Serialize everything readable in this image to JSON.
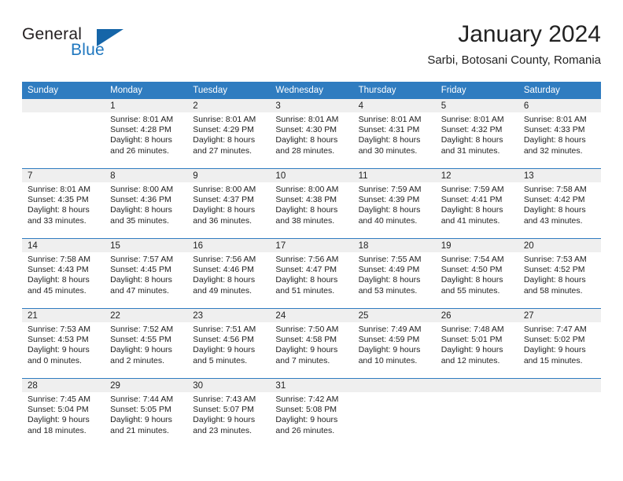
{
  "brand": {
    "line1": "General",
    "line2": "Blue",
    "triangle_color": "#1565a8",
    "blue_text_color": "#1f77bf"
  },
  "header": {
    "month_title": "January 2024",
    "location": "Sarbi, Botosani County, Romania"
  },
  "theme": {
    "header_blue": "#2f7cc0",
    "band_gray": "#efefef",
    "text": "#222222"
  },
  "calendar": {
    "weekday_headers": [
      "Sunday",
      "Monday",
      "Tuesday",
      "Wednesday",
      "Thursday",
      "Friday",
      "Saturday"
    ],
    "weeks": [
      [
        {
          "day": "",
          "sunrise": "",
          "sunset": "",
          "daylight_line1": "",
          "daylight_line2": "",
          "empty": true
        },
        {
          "day": "1",
          "sunrise": "Sunrise: 8:01 AM",
          "sunset": "Sunset: 4:28 PM",
          "daylight_line1": "Daylight: 8 hours",
          "daylight_line2": "and 26 minutes."
        },
        {
          "day": "2",
          "sunrise": "Sunrise: 8:01 AM",
          "sunset": "Sunset: 4:29 PM",
          "daylight_line1": "Daylight: 8 hours",
          "daylight_line2": "and 27 minutes."
        },
        {
          "day": "3",
          "sunrise": "Sunrise: 8:01 AM",
          "sunset": "Sunset: 4:30 PM",
          "daylight_line1": "Daylight: 8 hours",
          "daylight_line2": "and 28 minutes."
        },
        {
          "day": "4",
          "sunrise": "Sunrise: 8:01 AM",
          "sunset": "Sunset: 4:31 PM",
          "daylight_line1": "Daylight: 8 hours",
          "daylight_line2": "and 30 minutes."
        },
        {
          "day": "5",
          "sunrise": "Sunrise: 8:01 AM",
          "sunset": "Sunset: 4:32 PM",
          "daylight_line1": "Daylight: 8 hours",
          "daylight_line2": "and 31 minutes."
        },
        {
          "day": "6",
          "sunrise": "Sunrise: 8:01 AM",
          "sunset": "Sunset: 4:33 PM",
          "daylight_line1": "Daylight: 8 hours",
          "daylight_line2": "and 32 minutes."
        }
      ],
      [
        {
          "day": "7",
          "sunrise": "Sunrise: 8:01 AM",
          "sunset": "Sunset: 4:35 PM",
          "daylight_line1": "Daylight: 8 hours",
          "daylight_line2": "and 33 minutes."
        },
        {
          "day": "8",
          "sunrise": "Sunrise: 8:00 AM",
          "sunset": "Sunset: 4:36 PM",
          "daylight_line1": "Daylight: 8 hours",
          "daylight_line2": "and 35 minutes."
        },
        {
          "day": "9",
          "sunrise": "Sunrise: 8:00 AM",
          "sunset": "Sunset: 4:37 PM",
          "daylight_line1": "Daylight: 8 hours",
          "daylight_line2": "and 36 minutes."
        },
        {
          "day": "10",
          "sunrise": "Sunrise: 8:00 AM",
          "sunset": "Sunset: 4:38 PM",
          "daylight_line1": "Daylight: 8 hours",
          "daylight_line2": "and 38 minutes."
        },
        {
          "day": "11",
          "sunrise": "Sunrise: 7:59 AM",
          "sunset": "Sunset: 4:39 PM",
          "daylight_line1": "Daylight: 8 hours",
          "daylight_line2": "and 40 minutes."
        },
        {
          "day": "12",
          "sunrise": "Sunrise: 7:59 AM",
          "sunset": "Sunset: 4:41 PM",
          "daylight_line1": "Daylight: 8 hours",
          "daylight_line2": "and 41 minutes."
        },
        {
          "day": "13",
          "sunrise": "Sunrise: 7:58 AM",
          "sunset": "Sunset: 4:42 PM",
          "daylight_line1": "Daylight: 8 hours",
          "daylight_line2": "and 43 minutes."
        }
      ],
      [
        {
          "day": "14",
          "sunrise": "Sunrise: 7:58 AM",
          "sunset": "Sunset: 4:43 PM",
          "daylight_line1": "Daylight: 8 hours",
          "daylight_line2": "and 45 minutes."
        },
        {
          "day": "15",
          "sunrise": "Sunrise: 7:57 AM",
          "sunset": "Sunset: 4:45 PM",
          "daylight_line1": "Daylight: 8 hours",
          "daylight_line2": "and 47 minutes."
        },
        {
          "day": "16",
          "sunrise": "Sunrise: 7:56 AM",
          "sunset": "Sunset: 4:46 PM",
          "daylight_line1": "Daylight: 8 hours",
          "daylight_line2": "and 49 minutes."
        },
        {
          "day": "17",
          "sunrise": "Sunrise: 7:56 AM",
          "sunset": "Sunset: 4:47 PM",
          "daylight_line1": "Daylight: 8 hours",
          "daylight_line2": "and 51 minutes."
        },
        {
          "day": "18",
          "sunrise": "Sunrise: 7:55 AM",
          "sunset": "Sunset: 4:49 PM",
          "daylight_line1": "Daylight: 8 hours",
          "daylight_line2": "and 53 minutes."
        },
        {
          "day": "19",
          "sunrise": "Sunrise: 7:54 AM",
          "sunset": "Sunset: 4:50 PM",
          "daylight_line1": "Daylight: 8 hours",
          "daylight_line2": "and 55 minutes."
        },
        {
          "day": "20",
          "sunrise": "Sunrise: 7:53 AM",
          "sunset": "Sunset: 4:52 PM",
          "daylight_line1": "Daylight: 8 hours",
          "daylight_line2": "and 58 minutes."
        }
      ],
      [
        {
          "day": "21",
          "sunrise": "Sunrise: 7:53 AM",
          "sunset": "Sunset: 4:53 PM",
          "daylight_line1": "Daylight: 9 hours",
          "daylight_line2": "and 0 minutes."
        },
        {
          "day": "22",
          "sunrise": "Sunrise: 7:52 AM",
          "sunset": "Sunset: 4:55 PM",
          "daylight_line1": "Daylight: 9 hours",
          "daylight_line2": "and 2 minutes."
        },
        {
          "day": "23",
          "sunrise": "Sunrise: 7:51 AM",
          "sunset": "Sunset: 4:56 PM",
          "daylight_line1": "Daylight: 9 hours",
          "daylight_line2": "and 5 minutes."
        },
        {
          "day": "24",
          "sunrise": "Sunrise: 7:50 AM",
          "sunset": "Sunset: 4:58 PM",
          "daylight_line1": "Daylight: 9 hours",
          "daylight_line2": "and 7 minutes."
        },
        {
          "day": "25",
          "sunrise": "Sunrise: 7:49 AM",
          "sunset": "Sunset: 4:59 PM",
          "daylight_line1": "Daylight: 9 hours",
          "daylight_line2": "and 10 minutes."
        },
        {
          "day": "26",
          "sunrise": "Sunrise: 7:48 AM",
          "sunset": "Sunset: 5:01 PM",
          "daylight_line1": "Daylight: 9 hours",
          "daylight_line2": "and 12 minutes."
        },
        {
          "day": "27",
          "sunrise": "Sunrise: 7:47 AM",
          "sunset": "Sunset: 5:02 PM",
          "daylight_line1": "Daylight: 9 hours",
          "daylight_line2": "and 15 minutes."
        }
      ],
      [
        {
          "day": "28",
          "sunrise": "Sunrise: 7:45 AM",
          "sunset": "Sunset: 5:04 PM",
          "daylight_line1": "Daylight: 9 hours",
          "daylight_line2": "and 18 minutes."
        },
        {
          "day": "29",
          "sunrise": "Sunrise: 7:44 AM",
          "sunset": "Sunset: 5:05 PM",
          "daylight_line1": "Daylight: 9 hours",
          "daylight_line2": "and 21 minutes."
        },
        {
          "day": "30",
          "sunrise": "Sunrise: 7:43 AM",
          "sunset": "Sunset: 5:07 PM",
          "daylight_line1": "Daylight: 9 hours",
          "daylight_line2": "and 23 minutes."
        },
        {
          "day": "31",
          "sunrise": "Sunrise: 7:42 AM",
          "sunset": "Sunset: 5:08 PM",
          "daylight_line1": "Daylight: 9 hours",
          "daylight_line2": "and 26 minutes."
        },
        {
          "day": "",
          "sunrise": "",
          "sunset": "",
          "daylight_line1": "",
          "daylight_line2": "",
          "empty": true
        },
        {
          "day": "",
          "sunrise": "",
          "sunset": "",
          "daylight_line1": "",
          "daylight_line2": "",
          "empty": true
        },
        {
          "day": "",
          "sunrise": "",
          "sunset": "",
          "daylight_line1": "",
          "daylight_line2": "",
          "empty": true
        }
      ]
    ]
  }
}
